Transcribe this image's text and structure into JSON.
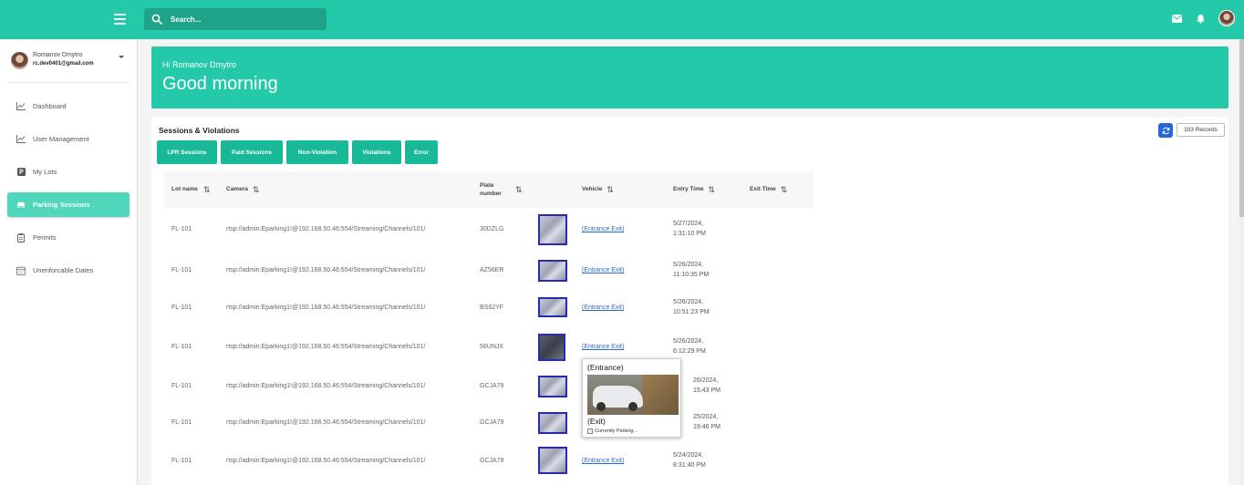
{
  "search": {
    "placeholder": "Search..."
  },
  "user": {
    "name": "Romanov Dmytro",
    "email": "rc.dev0401@gmail.com"
  },
  "sidebar": {
    "items": [
      {
        "label": "Dashboard",
        "icon": "chart-line-icon"
      },
      {
        "label": "User Management",
        "icon": "chart-line-icon"
      },
      {
        "label": "My Lots",
        "icon": "parking-icon"
      },
      {
        "label": "Parking Sessions",
        "icon": "car-icon",
        "active": true
      },
      {
        "label": "Permits",
        "icon": "clipboard-icon"
      },
      {
        "label": "Unenforcable Dates",
        "icon": "calendar-icon"
      }
    ]
  },
  "greeting": {
    "hi": "Hi Romanov Dmytro",
    "message": "Good morning"
  },
  "sessions": {
    "title": "Sessions & Violations",
    "records": "103 Records",
    "tabs": [
      "LPR Sessions",
      "Paid Sessions",
      "Non-Violation",
      "Violations",
      "Error"
    ],
    "columns": {
      "lot_name": "Lot name",
      "camera": "Camera",
      "plate_number": "Plate number",
      "vehicle": "Vehicle",
      "entry_time": "Entry Time",
      "exit_time": "Exit Time"
    },
    "rows": [
      {
        "lot": "FL-101",
        "camera": "rtsp://admin:Eparking1!@192.168.50.46:554/Streaming/Channels/101/",
        "plate": "30DZLG",
        "vehicle": "(Entrance Exit)",
        "entry_date": "5/27/2024,",
        "entry_time": "1:31:10 PM"
      },
      {
        "lot": "FL-101",
        "camera": "rtsp://admin:Eparking1!@192.168.50.46:554/Streaming/Channels/101/",
        "plate": "AZ56ER",
        "vehicle": "(Entrance Exit)",
        "entry_date": "5/26/2024,",
        "entry_time": "11:10:35 PM"
      },
      {
        "lot": "FL-101",
        "camera": "rtsp://admin:Eparking1!@192.168.50.46:554/Streaming/Channels/101/",
        "plate": "BS62YF",
        "vehicle": "(Entrance Exit)",
        "entry_date": "5/26/2024,",
        "entry_time": "10:51:23 PM"
      },
      {
        "lot": "FL-101",
        "camera": "rtsp://admin:Eparking1!@192.168.50.46:554/Streaming/Channels/101/",
        "plate": "56UNJX",
        "vehicle": "(Entrance Exit)",
        "entry_date": "5/26/2024,",
        "entry_time": "6:12:29 PM"
      },
      {
        "lot": "FL-101",
        "camera": "rtsp://admin:Eparking1!@192.168.50.46:554/Streaming/Channels/101/",
        "plate": "GCJA79",
        "vehicle": "",
        "entry_date": "26/2024,",
        "entry_time": "15:43 PM"
      },
      {
        "lot": "FL-101",
        "camera": "rtsp://admin:Eparking1!@192.168.50.46:554/Streaming/Channels/101/",
        "plate": "GCJA79",
        "vehicle": "",
        "entry_date": "25/2024,",
        "entry_time": "19:46 PM"
      },
      {
        "lot": "FL-101",
        "camera": "rtsp://admin:Eparking1!@192.168.50.46:554/Streaming/Channels/101/",
        "plate": "GCJA79",
        "vehicle": "(Entrance Exit)",
        "entry_date": "5/24/2024,",
        "entry_time": "8:31:40 PM"
      }
    ]
  },
  "popup": {
    "entrance": "(Entrance)",
    "exit": "(Exit)",
    "alt": "Currently Parking..."
  },
  "colors": {
    "primary": "#24c9aa",
    "tab": "#19b899",
    "active_nav": "#50d6bb",
    "link": "#2a6acb",
    "refresh": "#2668d8"
  }
}
